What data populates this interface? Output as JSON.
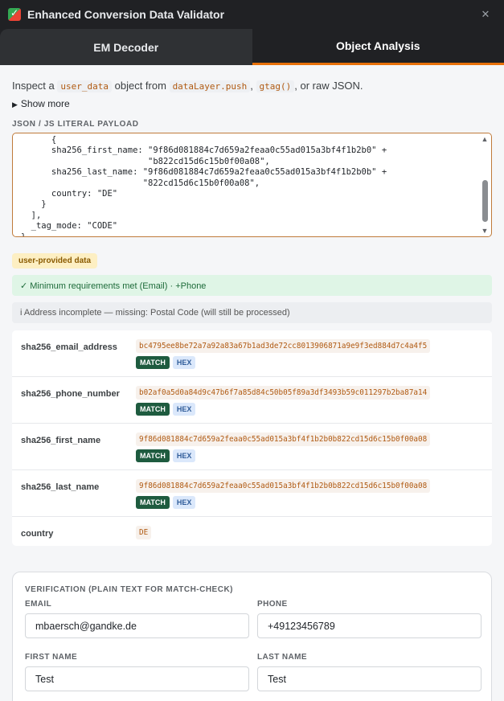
{
  "app": {
    "title": "Enhanced Conversion Data Validator"
  },
  "tabs": [
    {
      "label": "EM Decoder",
      "active": false
    },
    {
      "label": "Object Analysis",
      "active": true
    }
  ],
  "intro": {
    "prefix": "Inspect a",
    "code1": "user_data",
    "mid1": "object from",
    "code2": "dataLayer.push",
    "sep": ",",
    "code3": "gtag()",
    "suffix": ", or raw JSON."
  },
  "show_more": "Show more",
  "payload": {
    "label": "JSON / JS LITERAL PAYLOAD",
    "text": "      {\n      sha256_first_name: \"9f86d081884c7d659a2feaa0c55ad015a3bf4f1b2b0\" +\n                         \"b822cd15d6c15b0f00a08\",\n      sha256_last_name: \"9f86d081884c7d659a2feaa0c55ad015a3bf4f1b2b0b\" +\n                        \"822cd15d6c15b0f00a08\",\n      country: \"DE\"\n    }\n  ],\n  _tag_mode: \"CODE\"\n}"
  },
  "status": {
    "pill": "user-provided data",
    "requirements": "✓ Minimum requirements met (Email) · +Phone",
    "address": "i Address incomplete — missing: Postal Code (will still be processed)"
  },
  "fields": [
    {
      "name": "sha256_email_address",
      "value": "bc4795ee8be72a7a92a83a67b1ad3de72cc8013906871a9e9f3ed884d7c4a4f5",
      "badges": [
        "MATCH",
        "HEX"
      ]
    },
    {
      "name": "sha256_phone_number",
      "value": "b02af0a5d0a84d9c47b6f7a85d84c50b05f89a3df3493b59c011297b2ba87a14",
      "badges": [
        "MATCH",
        "HEX"
      ]
    },
    {
      "name": "sha256_first_name",
      "value": "9f86d081884c7d659a2feaa0c55ad015a3bf4f1b2b0b822cd15d6c15b0f00a08",
      "badges": [
        "MATCH",
        "HEX"
      ]
    },
    {
      "name": "sha256_last_name",
      "value": "9f86d081884c7d659a2feaa0c55ad015a3bf4f1b2b0b822cd15d6c15b0f00a08",
      "badges": [
        "MATCH",
        "HEX"
      ]
    },
    {
      "name": "country",
      "value": "DE",
      "badges": []
    }
  ],
  "verification": {
    "title": "VERIFICATION (PLAIN TEXT FOR MATCH-CHECK)",
    "email_label": "EMAIL",
    "email_value": "mbaersch@gandke.de",
    "phone_label": "PHONE",
    "phone_value": "+49123456789",
    "first_label": "FIRST NAME",
    "first_value": "Test",
    "last_label": "LAST NAME",
    "last_value": "Test"
  },
  "colors": {
    "accent": "#e8710a",
    "match": "#1e5b3f",
    "hex_badge": "#dbe8fb",
    "titlebar": "#202124"
  }
}
